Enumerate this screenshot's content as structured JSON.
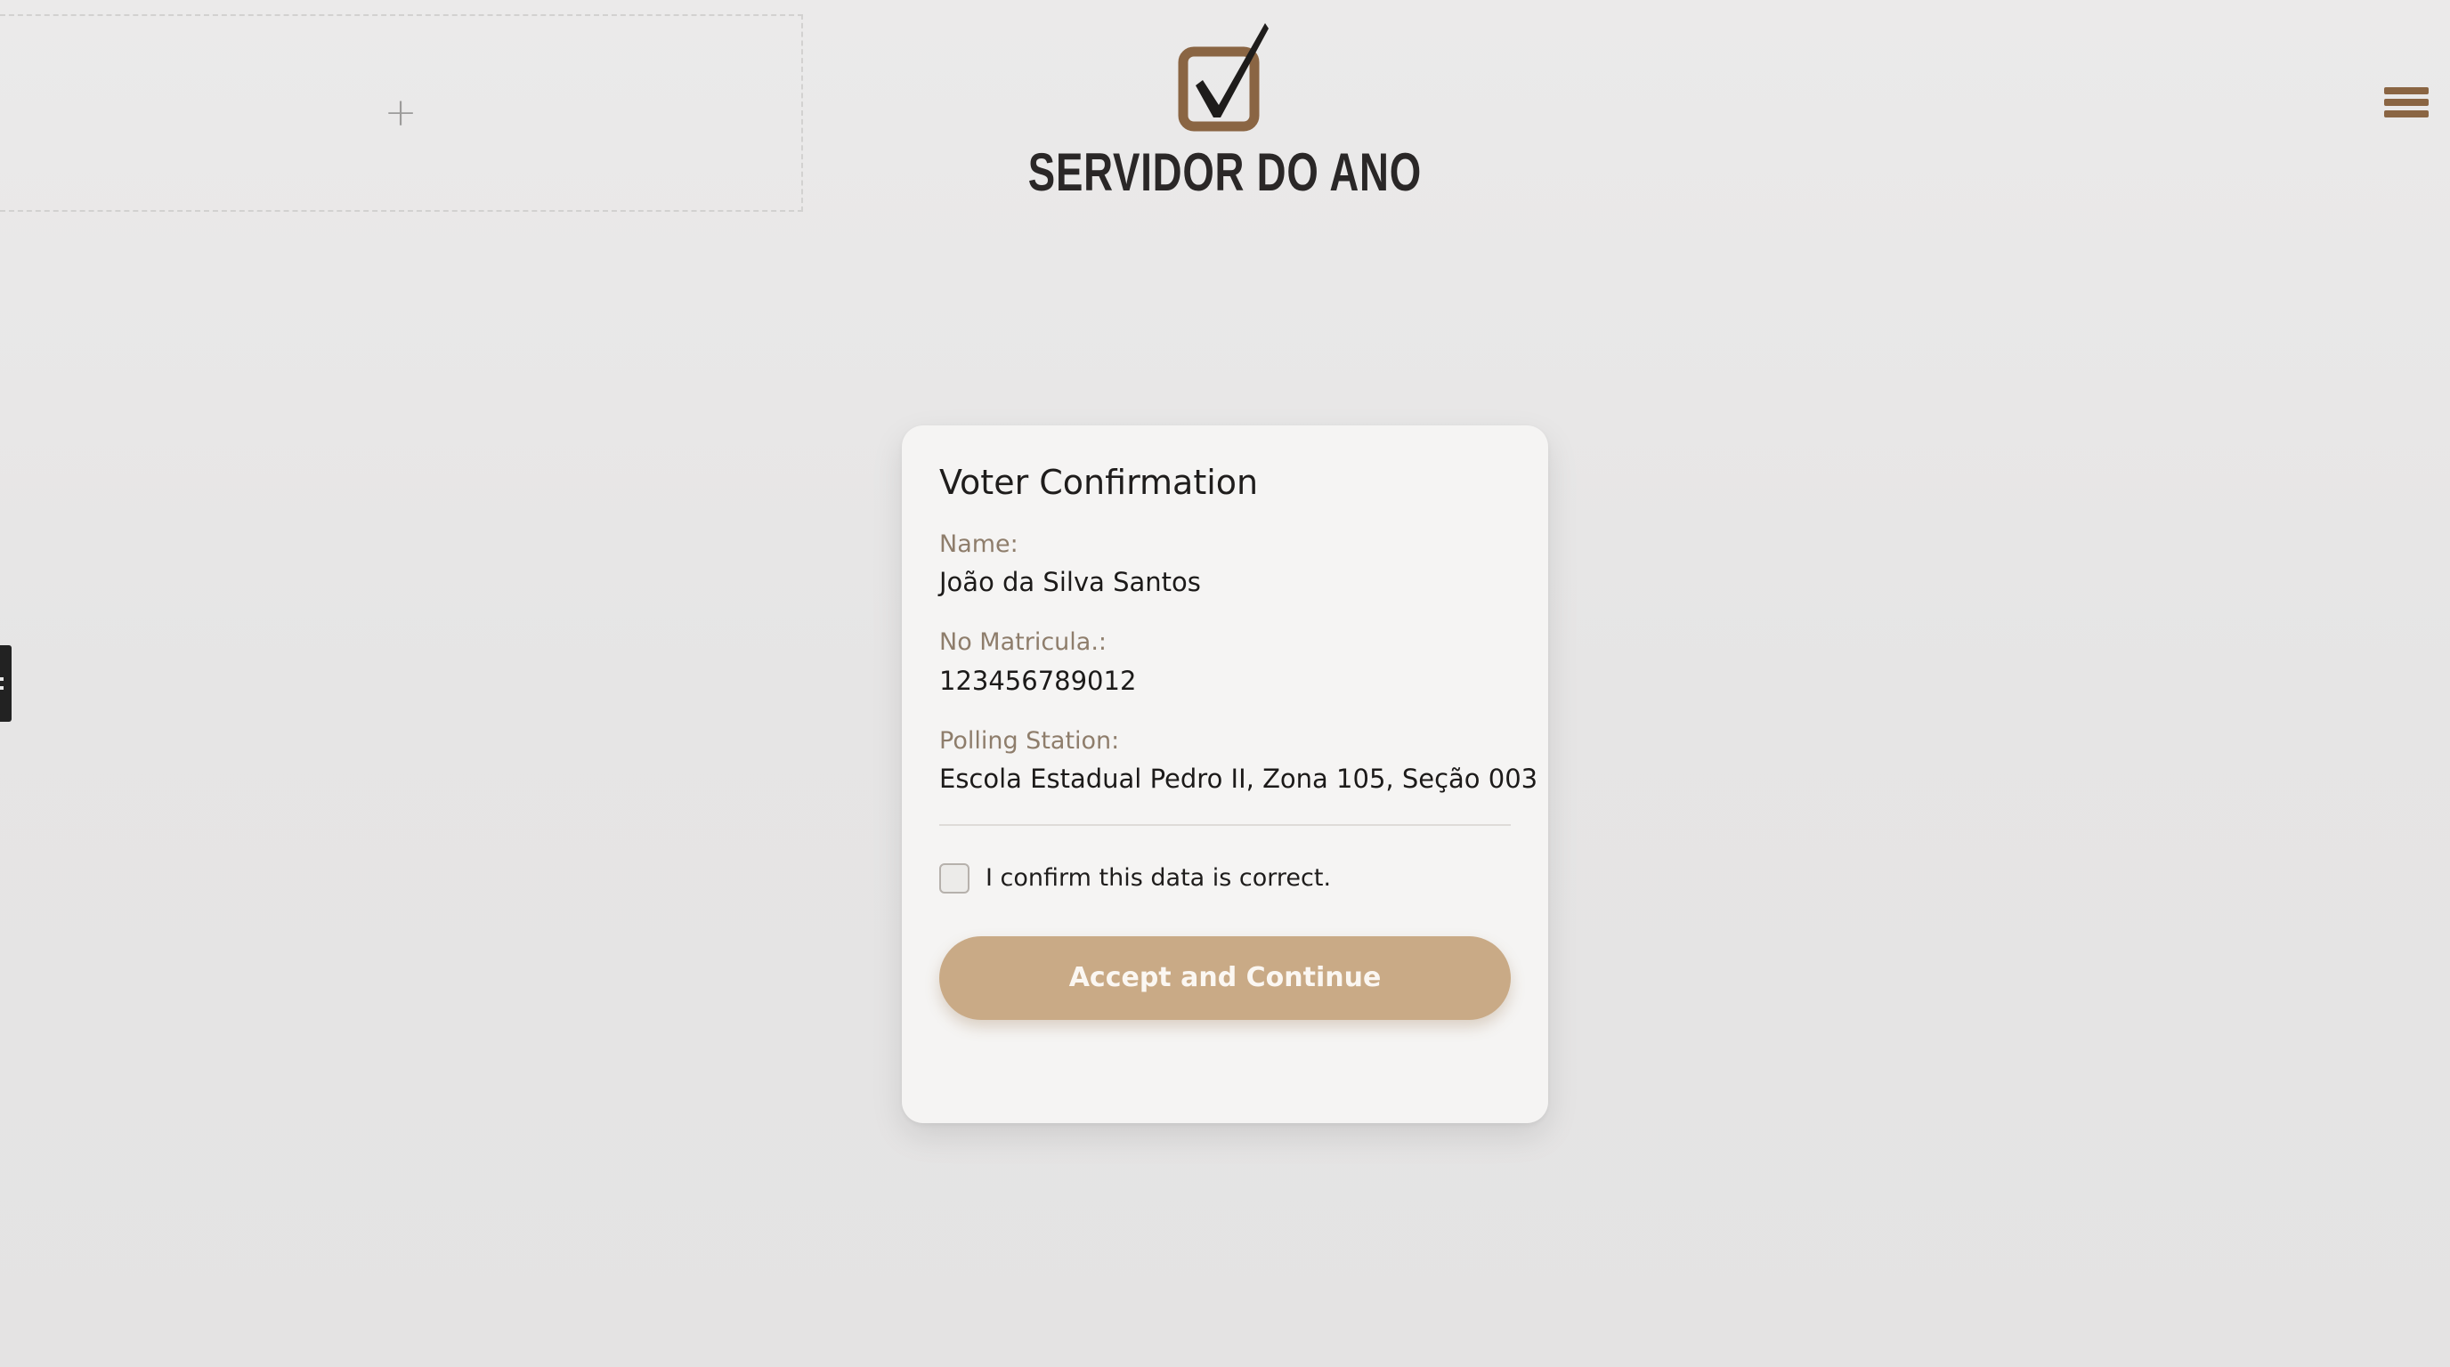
{
  "header": {
    "title": "SERVIDOR DO ANO",
    "logo_icon": "checkbox-checkmark-icon",
    "brand_color": "#8a6543"
  },
  "ad_slot": {
    "icon": "plus-icon",
    "symbol": "+"
  },
  "menu": {
    "icon": "hamburger-menu-icon"
  },
  "card": {
    "title": "Voter Confirmation",
    "fields": [
      {
        "label": "Name:",
        "value": "João da Silva Santos"
      },
      {
        "label": "No Matricula.:",
        "value": "123456789012"
      },
      {
        "label": "Polling Station:",
        "value": "Escola Estadual Pedro II, Zona 105, Seção 003"
      }
    ],
    "confirm_label": "I confirm this data is correct.",
    "confirm_checked": false,
    "button_label": "Accept and Continue",
    "button_color": "#c9aa86"
  }
}
